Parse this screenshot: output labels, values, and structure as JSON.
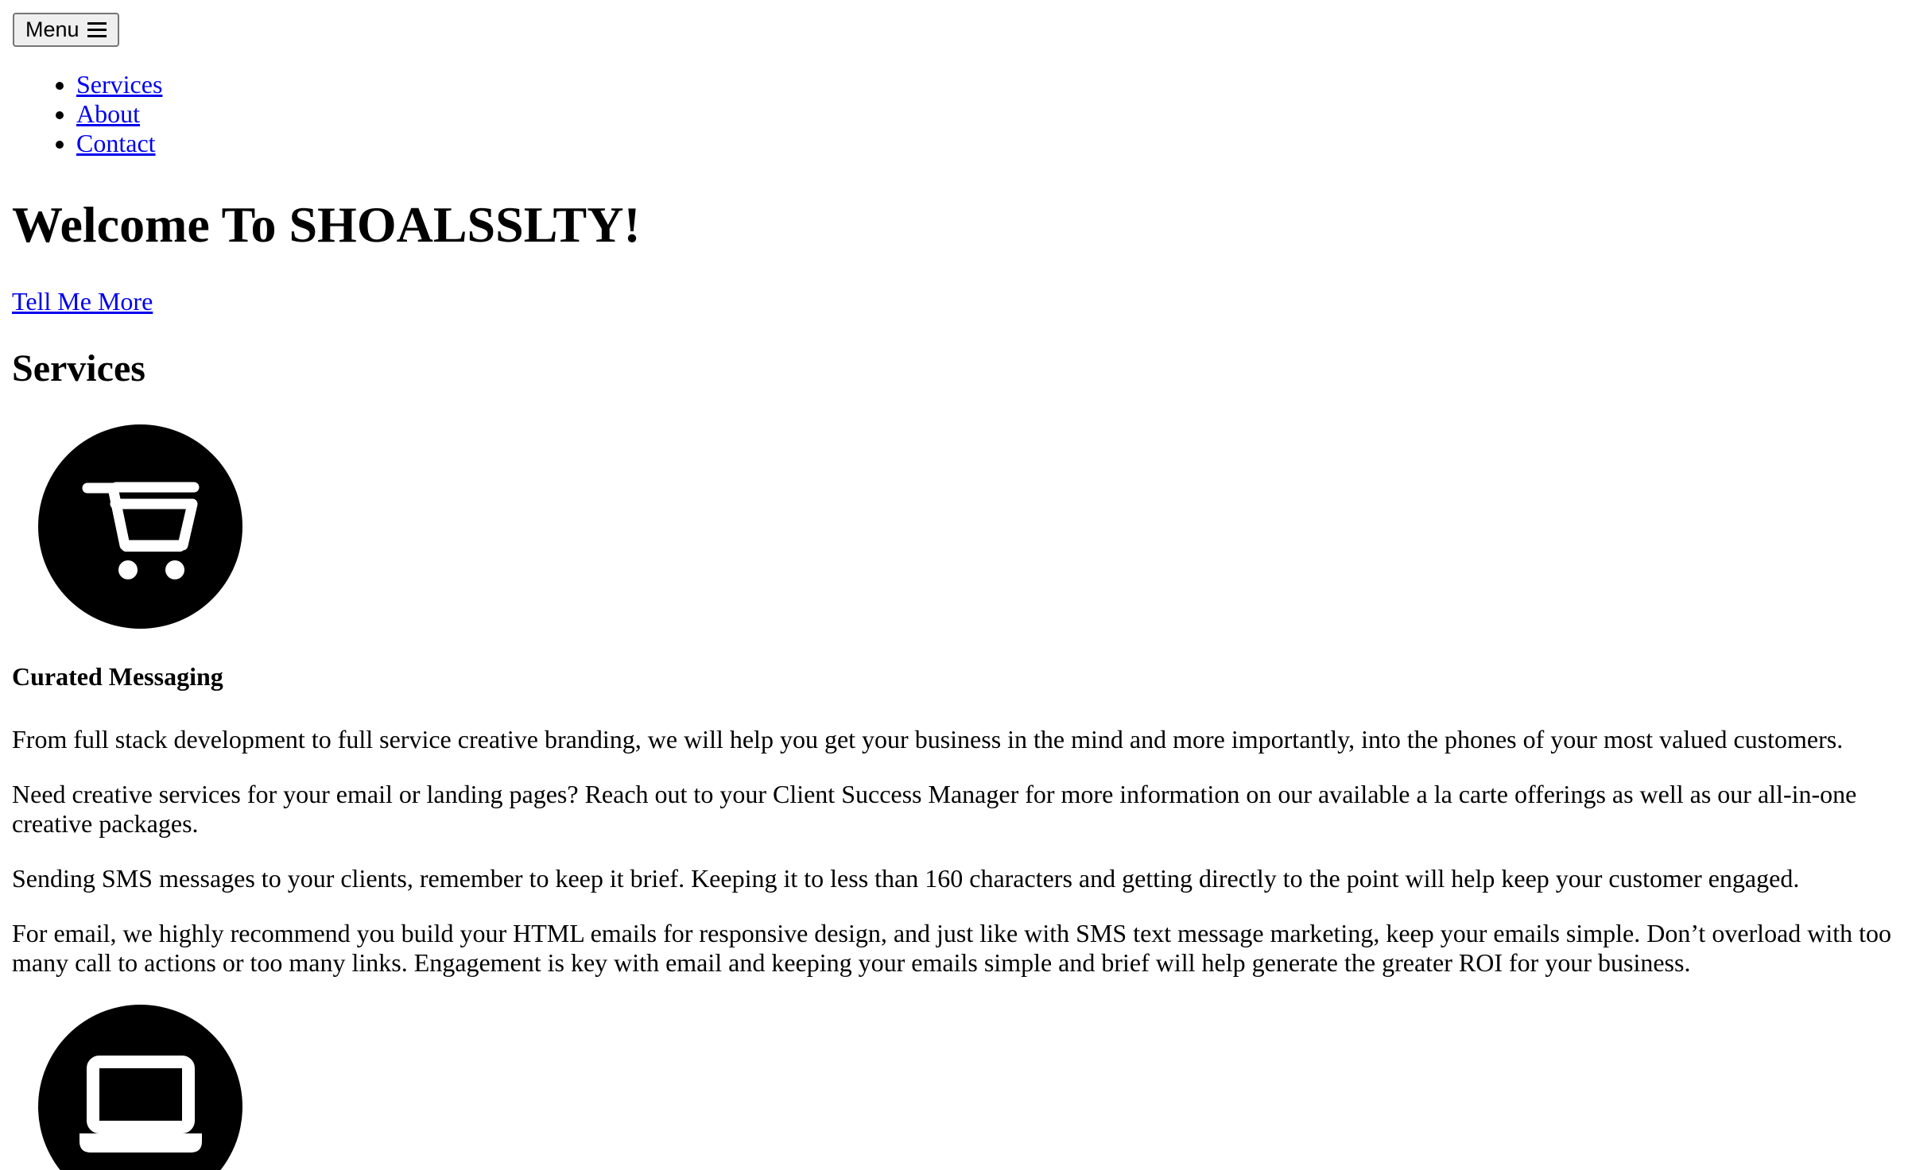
{
  "navigation": {
    "menu_label": "Menu",
    "menu_icon": "hamburger-icon",
    "items": [
      {
        "label": "Services"
      },
      {
        "label": "About"
      },
      {
        "label": "Contact"
      }
    ]
  },
  "hero": {
    "title": "Welcome To SHOALSSLTY!",
    "link_label": "Tell Me More"
  },
  "services": {
    "title": "Services",
    "items": [
      {
        "icon": "shopping-cart-icon",
        "heading": "Curated Messaging"
      },
      {
        "icon": "laptop-icon"
      }
    ],
    "paragraphs": [
      "From full stack development to full service creative branding, we will help you get your business in the mind and more importantly, into the phones of your most valued customers.",
      "Need creative services for your email or landing pages? Reach out to your Client Success Manager for more information on our available a la carte offerings as well as our all-in-one creative packages.",
      "Sending SMS messages to your clients, remember to keep it brief. Keeping it to less than 160 characters and getting directly to the point will help keep your customer engaged.",
      "For email, we highly recommend you build your HTML emails for responsive design, and just like with SMS text message marketing, keep your emails simple. Don’t overload with too many call to actions or too many links. Engagement is key with email and keeping your emails simple and brief will help generate the greater ROI for your business."
    ]
  },
  "colors": {
    "link": "#0000ee",
    "text": "#000000",
    "background": "#ffffff",
    "icon_background": "#000000",
    "icon_foreground": "#ffffff"
  }
}
